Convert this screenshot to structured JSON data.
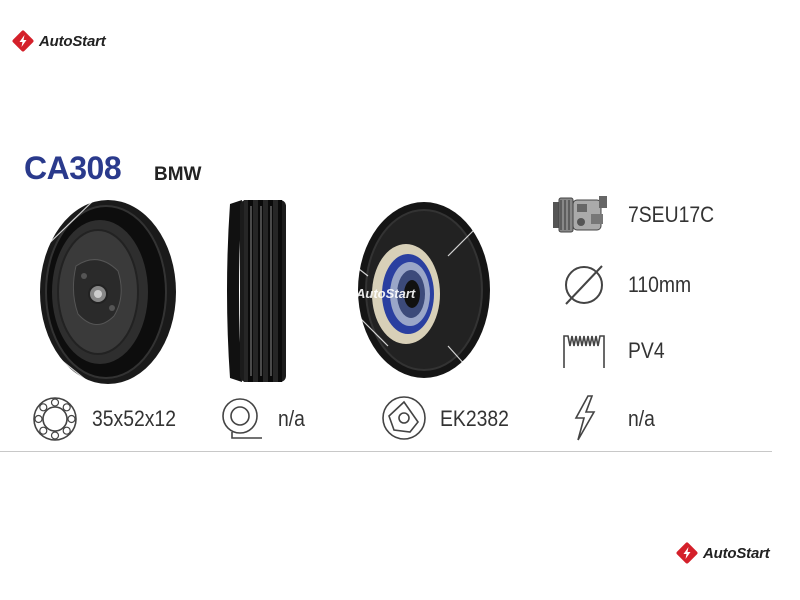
{
  "brand_logo": {
    "text": "AutoStart",
    "color": "#d4202a"
  },
  "product": {
    "code": "CA308",
    "make": "BMW",
    "code_color": "#2a3a8c"
  },
  "watermark": "AutoStart",
  "specs": {
    "compressor": "7SEU17C",
    "diameter": "110mm",
    "belt": "PV4",
    "bearing": "35x52x12",
    "coil": "n/a",
    "hub": "EK2382",
    "voltage": "n/a"
  },
  "icons": {
    "compressor": "compressor-icon",
    "diameter": "diameter-icon",
    "belt": "belt-grooves-icon",
    "bearing": "bearing-icon",
    "coil": "coil-icon",
    "hub": "hub-plate-icon",
    "voltage": "voltage-icon"
  }
}
